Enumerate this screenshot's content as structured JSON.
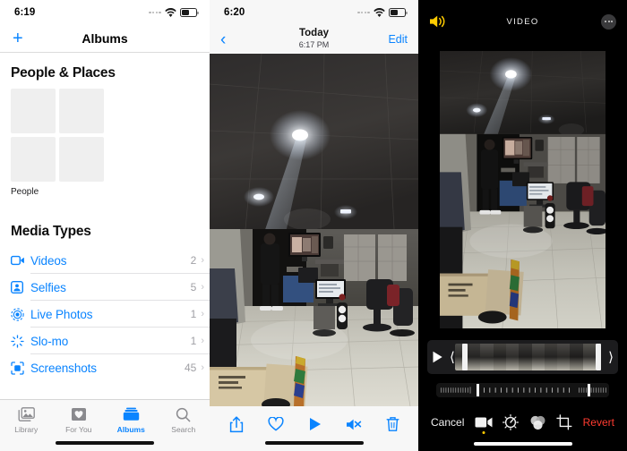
{
  "panel_albums": {
    "status_bar": {
      "time": "6:19",
      "wifi_icon": "wifi-icon",
      "battery_icon": "battery-icon",
      "signal_icon": "signal-dots-icon"
    },
    "nav": {
      "add_icon": "plus-icon",
      "title": "Albums"
    },
    "people_places": {
      "section_title": "People & Places",
      "thumb_label": "People",
      "thumb_count": 4
    },
    "media_types": {
      "section_title": "Media Types",
      "rows": [
        {
          "icon": "video-camera-icon",
          "label": "Videos",
          "count": "2",
          "chevron": "chevron-right-icon"
        },
        {
          "icon": "selfie-portrait-icon",
          "label": "Selfies",
          "count": "5",
          "chevron": "chevron-right-icon"
        },
        {
          "icon": "live-photo-icon",
          "label": "Live Photos",
          "count": "1",
          "chevron": "chevron-right-icon"
        },
        {
          "icon": "slomo-icon",
          "label": "Slo-mo",
          "count": "1",
          "chevron": "chevron-right-icon"
        },
        {
          "icon": "screenshot-icon",
          "label": "Screenshots",
          "count": "45",
          "chevron": "chevron-right-icon"
        }
      ]
    },
    "tab_bar": {
      "tabs": [
        {
          "icon": "photos-library-icon",
          "label": "Library",
          "active": false
        },
        {
          "icon": "for-you-heart-icon",
          "label": "For You",
          "active": false
        },
        {
          "icon": "albums-folder-icon",
          "label": "Albums",
          "active": true
        },
        {
          "icon": "search-icon",
          "label": "Search",
          "active": false
        }
      ]
    }
  },
  "panel_viewer": {
    "status_bar": {
      "time": "6:20"
    },
    "nav": {
      "back_icon": "chevron-left-icon",
      "title": "Today",
      "subtitle": "6:17 PM",
      "edit_label": "Edit"
    },
    "photo": {
      "alt_name": "room-interior-photo"
    },
    "toolbar": [
      {
        "icon": "share-icon",
        "name": "share-button"
      },
      {
        "icon": "heart-icon",
        "name": "favorite-button"
      },
      {
        "icon": "play-icon",
        "name": "play-button"
      },
      {
        "icon": "speaker-muted-icon",
        "name": "mute-button"
      },
      {
        "icon": "trash-icon",
        "name": "delete-button"
      }
    ]
  },
  "panel_editor": {
    "nav": {
      "speaker_icon": "speaker-on-icon",
      "title": "VIDEO",
      "more_icon": "more-options-icon"
    },
    "preview": {
      "alt_name": "room-interior-video-frame"
    },
    "trim": {
      "play_icon": "play-icon",
      "left_handle": "trim-handle-left",
      "right_handle": "trim-handle-right"
    },
    "ruler": {
      "name": "video-scrubber-ruler"
    },
    "tools": {
      "cancel_label": "Cancel",
      "revert_label": "Revert",
      "items": [
        {
          "icon": "video-trim-icon",
          "active": true
        },
        {
          "icon": "adjust-dial-icon",
          "active": false
        },
        {
          "icon": "filters-icon",
          "active": false
        },
        {
          "icon": "crop-rotate-icon",
          "active": false
        }
      ]
    }
  },
  "colors": {
    "ios_blue": "#0a84ff",
    "yellow_accent": "#ffcc00",
    "revert_red": "#ff3b30",
    "separator": "#e2e2e4",
    "tab_inactive": "#8a8a8e"
  }
}
